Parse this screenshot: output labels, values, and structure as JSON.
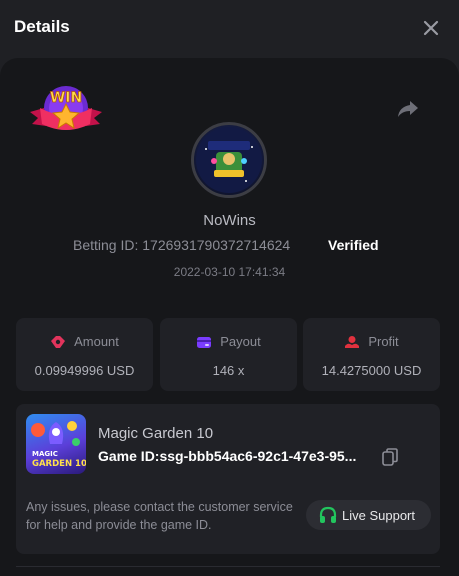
{
  "header": {
    "title": "Details",
    "close_icon": "close-icon"
  },
  "bet": {
    "username": "NoWins",
    "betting_id": "Betting ID: 1726931790372714624",
    "verified": "Verified",
    "time": "2022-03-10 17:41:34",
    "badge_text": "WIN"
  },
  "stats": [
    {
      "label": "Amount",
      "value": "0.09949996 USD",
      "icon": "amount-icon",
      "color": "#e2345c"
    },
    {
      "label": "Payout",
      "value": "146 x",
      "icon": "payout-icon",
      "color": "#7a3cff"
    },
    {
      "label": "Profit",
      "value": "14.4275000 USD",
      "icon": "profit-icon",
      "color": "#e0313e"
    }
  ],
  "game": {
    "name": "Magic Garden 10",
    "game_id": "Game ID:ssg-bbb54ac6-92c1-47e3-95...",
    "thumb_text_1": "MAGIC",
    "thumb_text_2": "GARDEN 10",
    "issue_text": "Any issues, please contact the customer service for help and provide the game ID.",
    "support_label": "Live Support"
  },
  "colors": {
    "accent_green": "#22c55e",
    "panel": "#16171a",
    "card": "#202126"
  }
}
